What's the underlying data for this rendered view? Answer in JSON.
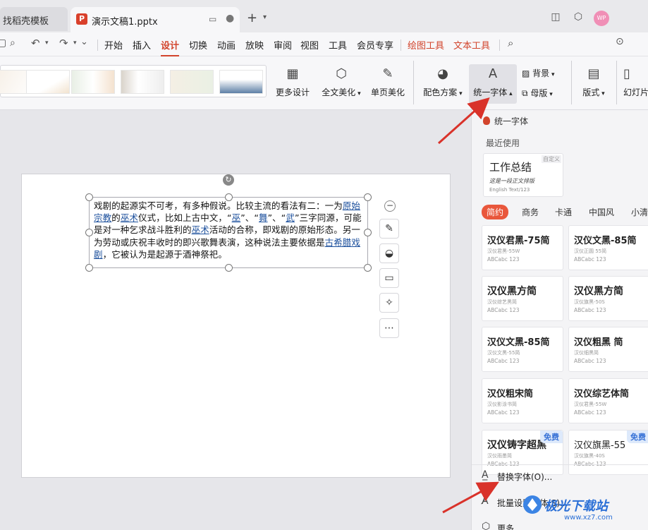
{
  "titlebar": {
    "tab1": "找稻壳模板",
    "tab2": "演示文稿1.pptx",
    "tab2_icon": "P",
    "avatar": "WP"
  },
  "menubar": {
    "items": [
      "开始",
      "插入",
      "设计",
      "切换",
      "动画",
      "放映",
      "审阅",
      "视图",
      "工具",
      "会员专享"
    ],
    "context": [
      "绘图工具",
      "文本工具"
    ]
  },
  "ribbon": {
    "more_design": "更多设计",
    "beautify_all": "全文美化",
    "beautify_page": "单页美化",
    "color_scheme": "配色方案",
    "unify_font": "统一字体",
    "background": "背景",
    "master": "母版",
    "layout": "版式",
    "slide_size": "幻灯片"
  },
  "slide": {
    "text_parts": [
      {
        "t": "戏剧的起源实不可考，有多种假说。比较主流的看法有二：一为"
      },
      {
        "t": "原始宗教",
        "link": true
      },
      {
        "t": "的"
      },
      {
        "t": "巫术",
        "link": true
      },
      {
        "t": "仪式，比如上古中文，“"
      },
      {
        "t": "巫",
        "link": true
      },
      {
        "t": "”、“"
      },
      {
        "t": "舞",
        "link": true
      },
      {
        "t": "”、“"
      },
      {
        "t": "武",
        "link": true
      },
      {
        "t": "”三字同源，可能是对一种乞求战斗胜利的"
      },
      {
        "t": "巫术",
        "link": true
      },
      {
        "t": "活动的合称，即戏剧的原始形态。另一为劳动或庆祝丰收时的即兴歌舞表演，这种说法主要依据是"
      },
      {
        "t": "古希腊戏剧",
        "link": true
      },
      {
        "t": "，它被认为是起源于酒神祭祀。"
      }
    ]
  },
  "panel": {
    "title": "统一字体",
    "recent_label": "最近使用",
    "recent_card": {
      "tag": "自定义",
      "big": "工作总结",
      "mid": "这是一段正文排版",
      "small": "English Text/123"
    },
    "categories": [
      "简约",
      "商务",
      "卡通",
      "中国风",
      "小清"
    ],
    "fonts": [
      {
        "name": "汉仪君黑-75简",
        "sub": "汉仪君黑-55W",
        "sample": "ABCabc 123",
        "style": "bold"
      },
      {
        "name": "汉仪文黑-85简",
        "sub": "汉仪正圆 55简",
        "sample": "ABCabc 123",
        "style": "bold"
      },
      {
        "name": "汉仪黑方简",
        "sub": "汉仪综艺黑简",
        "sample": "ABCabc 123",
        "style": "heavy"
      },
      {
        "name": "汉仪黑方简",
        "sub": "汉仪旗黑-50S",
        "sample": "ABCabc 123",
        "style": "heavy"
      },
      {
        "name": "汉仪文黑-85简",
        "sub": "汉仪文黑-55简",
        "sample": "ABCabc 123",
        "style": "bold"
      },
      {
        "name": "汉仪粗黑 简",
        "sub": "汉仪细黑简",
        "sample": "ABCabc 123",
        "style": "bold"
      },
      {
        "name": "汉仪粗宋简",
        "sub": "汉仪影涂书简",
        "sample": "ABCabc 123",
        "style": "bold"
      },
      {
        "name": "汉仪综艺体简",
        "sub": "汉仪君黑-55W",
        "sample": "ABCabc 123",
        "style": "bold"
      },
      {
        "name": "汉仪铸字超黑",
        "sub": "汉仪雨墨简",
        "sample": "ABCabc 123",
        "style": "heavy",
        "free": "免费"
      },
      {
        "name": "汉仪旗黑-55",
        "sub": "汉仪旗黑-40S",
        "sample": "ABCabc 123",
        "style": "light",
        "free": "免费"
      }
    ],
    "replace_font": "替换字体(O)...",
    "batch_font": "批量设置字体(S)...",
    "more": "更多"
  },
  "watermark": {
    "text": "极光下载站",
    "url": "www.xz7.com"
  },
  "colors": {
    "accent": "#d2442c",
    "arrow": "#d9322a",
    "link": "#1b4f9c"
  }
}
